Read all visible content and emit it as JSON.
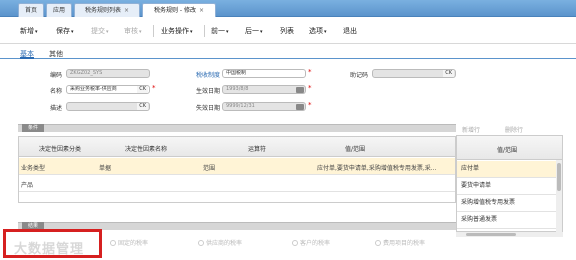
{
  "tabs": [
    {
      "label": "首页"
    },
    {
      "label": "应用"
    },
    {
      "label": "税务规则列表",
      "close": "×"
    },
    {
      "label": "税务规则 - 修改",
      "close": "×"
    }
  ],
  "toolbar": {
    "new": "新增",
    "save": "保存",
    "submit": "提交",
    "audit": "审核",
    "tax_ops": "业务操作",
    "prev": "前一",
    "next": "后一",
    "list": "列表",
    "options": "选项",
    "exit": "退出",
    "caret": "▾"
  },
  "subtabs": {
    "basic": "基本",
    "other": "其他"
  },
  "form": {
    "code_label": "编码",
    "code_value": "ZKGZ02_SYS",
    "tax_system_label": "税收制度",
    "tax_system_value": "中国税制",
    "mnemonic_label": "助记码",
    "mnemonic_btn": "CK",
    "name_label": "名称",
    "name_value": "采购业务税率-供应商",
    "name_btn": "CK",
    "effective_label": "生效日期",
    "effective_value": "1993/8/8",
    "desc_label": "描述",
    "desc_btn": "CK",
    "expire_label": "失效日期",
    "expire_value": "9999/12/31",
    "required": "*"
  },
  "conditions": {
    "section_label": "条件",
    "columns": [
      "决定性因素分类",
      "决定性因素名称",
      "运算符",
      "值/范围"
    ],
    "rows": [
      {
        "cat": "业务类型",
        "name": "单据",
        "op": "范围",
        "value": "应付单,要货申请单,采购增值税专用发票,采..."
      },
      {
        "cat": "产品",
        "name": "",
        "op": "",
        "value": ""
      }
    ]
  },
  "side_buttons": {
    "new_row": "新增行",
    "delete_row": "删除行"
  },
  "value_panel": {
    "header": "值/范围",
    "items": [
      "应付单",
      "要货申请单",
      "采购增值税专用发票",
      "采购普通发票"
    ]
  },
  "result": {
    "section_label": "结果",
    "options": [
      "固定的税率",
      "供应商的税率",
      "客户的税率",
      "费用项目的税率"
    ]
  },
  "watermark": "大数据管理"
}
